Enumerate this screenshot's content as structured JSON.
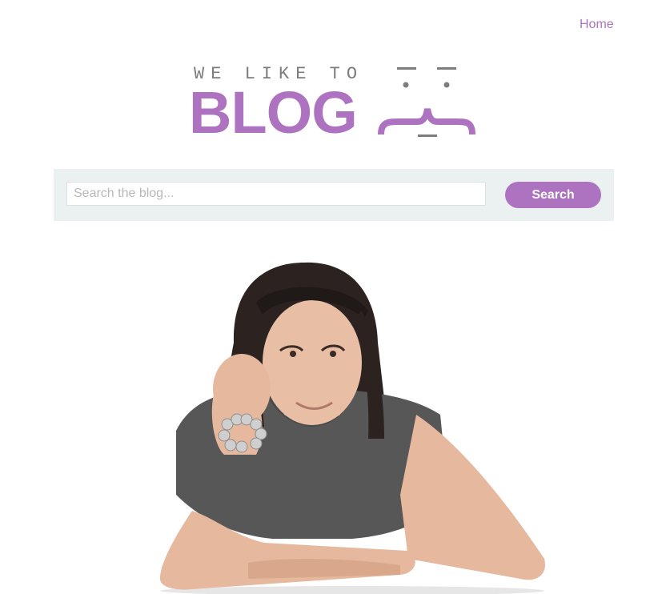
{
  "nav": {
    "home_label": "Home"
  },
  "logo": {
    "tagline": "WE LIKE TO",
    "word": "BLOG"
  },
  "search": {
    "placeholder": "Search the blog...",
    "button_label": "Search"
  },
  "hero": {
    "image_icon": "person-photo"
  },
  "colors": {
    "accent": "#ad73c0",
    "search_bar_bg": "#ebf0f0",
    "logo_gray": "#7d7d7d"
  }
}
